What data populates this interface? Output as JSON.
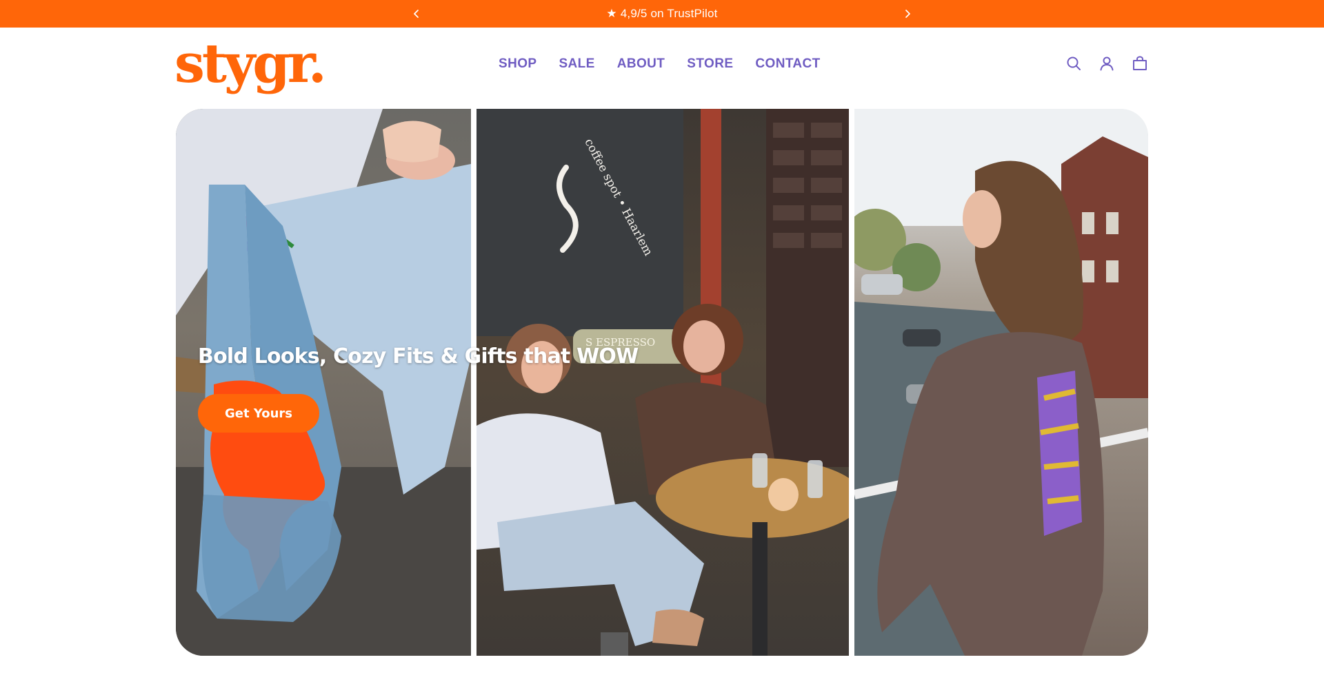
{
  "announcement": {
    "text": "★ 4,9/5 on TrustPilot",
    "prev_icon": "chevron-left-icon",
    "next_icon": "chevron-right-icon"
  },
  "header": {
    "logo": "stygr.",
    "nav": [
      "SHOP",
      "SALE",
      "ABOUT",
      "STORE",
      "CONTACT"
    ],
    "icons": [
      "search-icon",
      "account-icon",
      "cart-icon"
    ]
  },
  "hero": {
    "headline": "Bold Looks, Cozy Fits & Gifts that WOW",
    "cta": "Get Yours",
    "window_text": "coffee spot • Haarlem",
    "sign_text": "S ESPRESSO"
  },
  "colors": {
    "brand_orange": "#ff6609",
    "nav_purple": "#6f5cc2",
    "white": "#ffffff"
  }
}
